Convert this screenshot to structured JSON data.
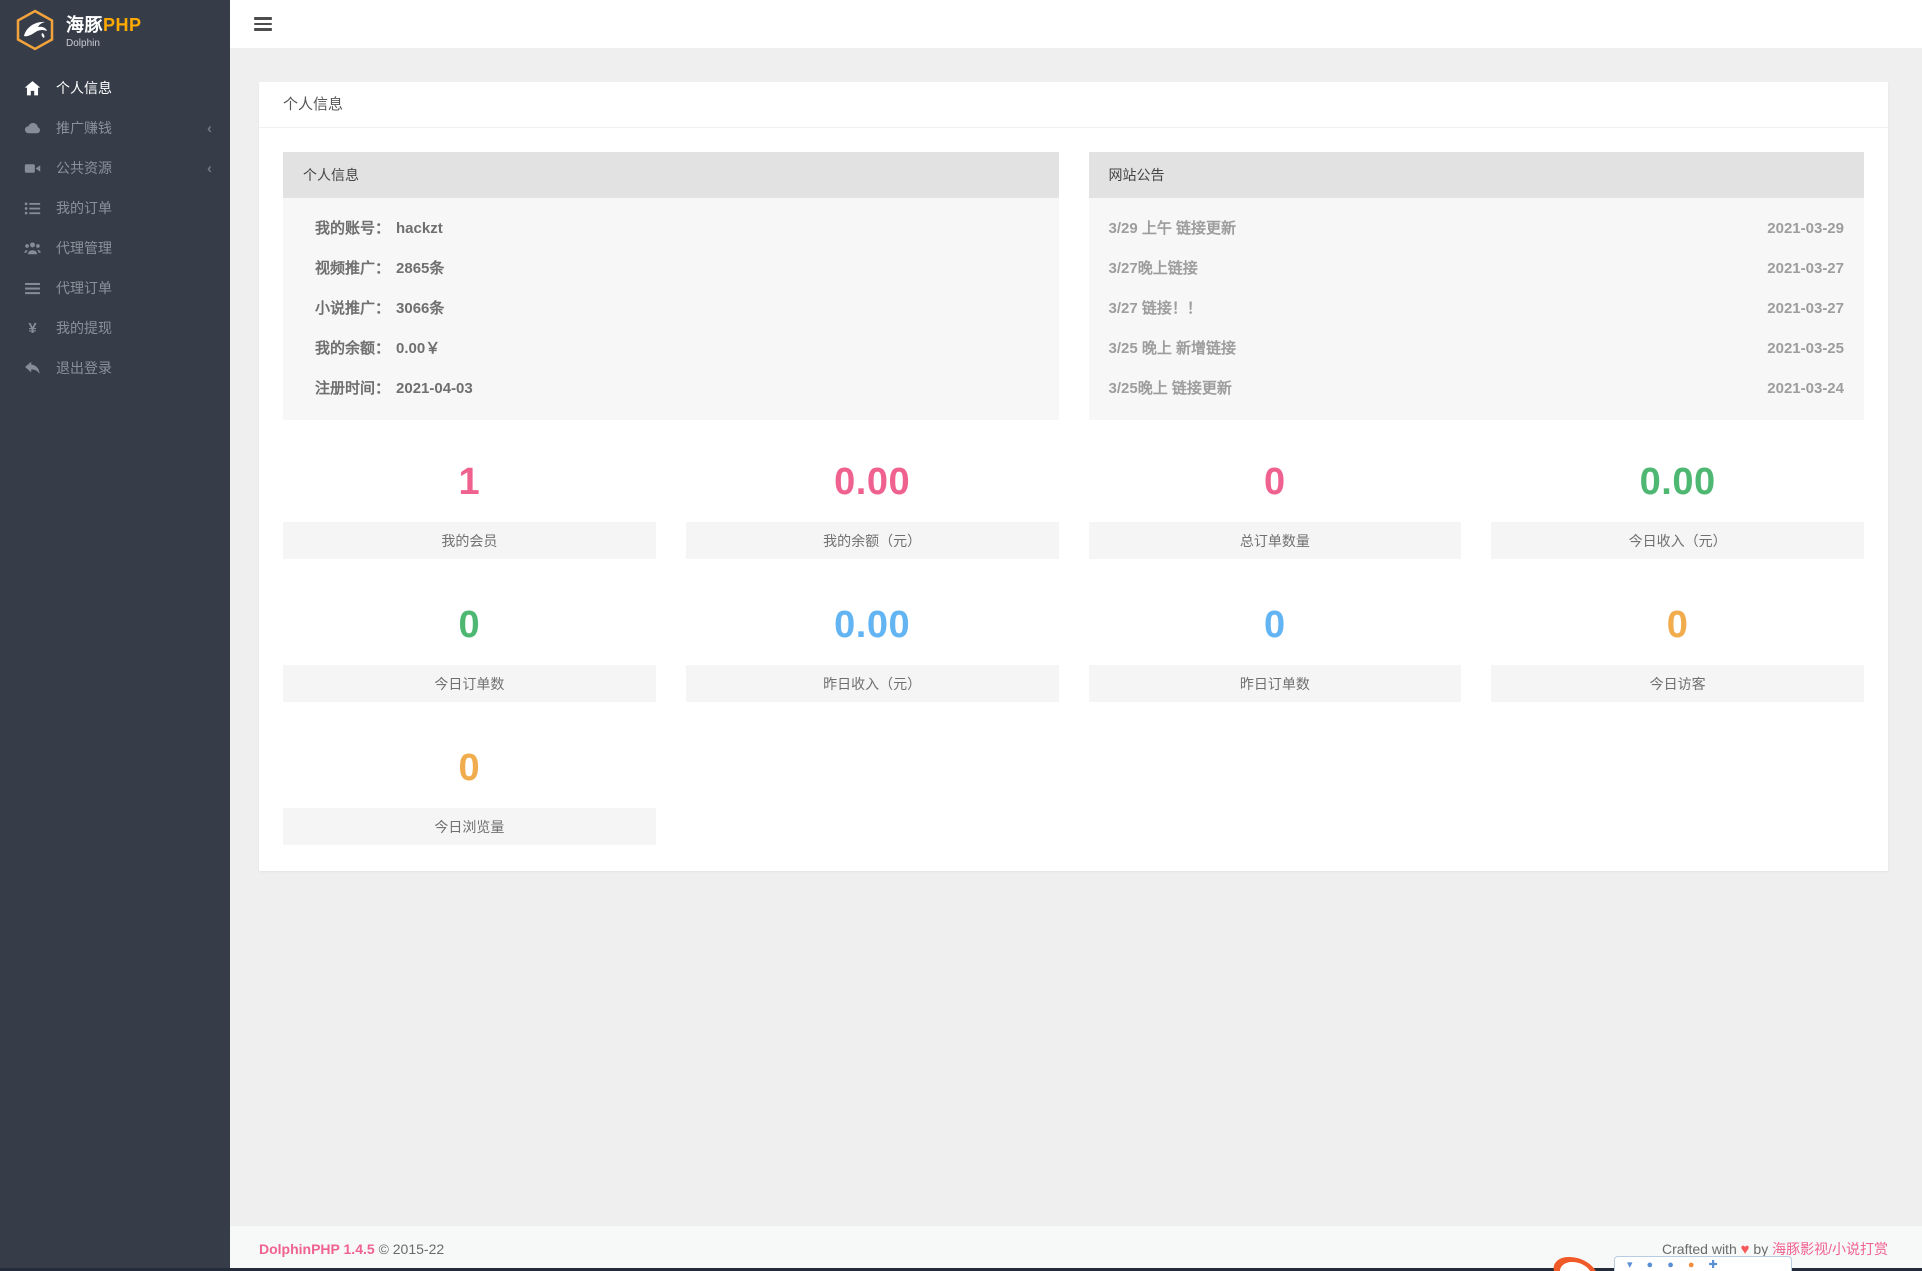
{
  "sidebar": {
    "logo": {
      "title_cn": "海豚",
      "title_php": "PHP",
      "subtitle": "Dolphin"
    },
    "submenu_indicator": "‹",
    "items": [
      {
        "label": "个人信息",
        "icon": "home-icon",
        "active": true,
        "has_submenu": false
      },
      {
        "label": "推广赚钱",
        "icon": "cloud-icon",
        "active": false,
        "has_submenu": true
      },
      {
        "label": "公共资源",
        "icon": "video-icon",
        "active": false,
        "has_submenu": true
      },
      {
        "label": "我的订单",
        "icon": "list-icon",
        "active": false,
        "has_submenu": false
      },
      {
        "label": "代理管理",
        "icon": "users-icon",
        "active": false,
        "has_submenu": false
      },
      {
        "label": "代理订单",
        "icon": "bars-icon",
        "active": false,
        "has_submenu": false
      },
      {
        "label": "我的提现",
        "icon": "yen-icon",
        "active": false,
        "has_submenu": false
      },
      {
        "label": "退出登录",
        "icon": "logout-icon",
        "active": false,
        "has_submenu": false
      }
    ]
  },
  "page": {
    "title": "个人信息"
  },
  "profile_panel": {
    "title": "个人信息",
    "rows": [
      {
        "label": "我的账号：",
        "value": "hackzt"
      },
      {
        "label": "视频推广：",
        "value": "2865条"
      },
      {
        "label": "小说推广：",
        "value": "3066条"
      },
      {
        "label": "我的余额：",
        "value": "0.00￥"
      },
      {
        "label": "注册时间：",
        "value": "2021-04-03"
      }
    ]
  },
  "announcement_panel": {
    "title": "网站公告",
    "items": [
      {
        "title": "3/29 上午 链接更新",
        "date": "2021-03-29"
      },
      {
        "title": "3/27晚上链接",
        "date": "2021-03-27"
      },
      {
        "title": "3/27 链接！！",
        "date": "2021-03-27"
      },
      {
        "title": "3/25 晚上 新增链接",
        "date": "2021-03-25"
      },
      {
        "title": "3/25晚上 链接更新",
        "date": "2021-03-24"
      }
    ]
  },
  "stats": [
    {
      "value": "1",
      "label": "我的会员",
      "color": "#ef628f"
    },
    {
      "value": "0.00",
      "label": "我的余额（元）",
      "color": "#ef628f"
    },
    {
      "value": "0",
      "label": "总订单数量",
      "color": "#ef628f"
    },
    {
      "value": "0.00",
      "label": "今日收入（元）",
      "color": "#4eb873"
    },
    {
      "value": "0",
      "label": "今日订单数",
      "color": "#4eb873"
    },
    {
      "value": "0.00",
      "label": "昨日收入（元）",
      "color": "#62b4f2"
    },
    {
      "value": "0",
      "label": "昨日订单数",
      "color": "#62b4f2"
    },
    {
      "value": "0",
      "label": "今日访客",
      "color": "#f0ac4d"
    },
    {
      "value": "0",
      "label": "今日浏览量",
      "color": "#f0ac4d"
    }
  ],
  "footer": {
    "brand": "DolphinPHP 1.4.5",
    "copyright": "© 2015-22",
    "crafted_prefix": "Crafted with",
    "heart": "♥",
    "crafted_by": "by",
    "link": "海豚影视/小说打赏"
  },
  "colors": {
    "sidebar_bg": "#363d49",
    "accent_pink": "#ef628f",
    "accent_green": "#4eb873",
    "accent_blue": "#62b4f2",
    "accent_orange": "#f0ac4d",
    "logo_orange": "#ffaa00"
  }
}
